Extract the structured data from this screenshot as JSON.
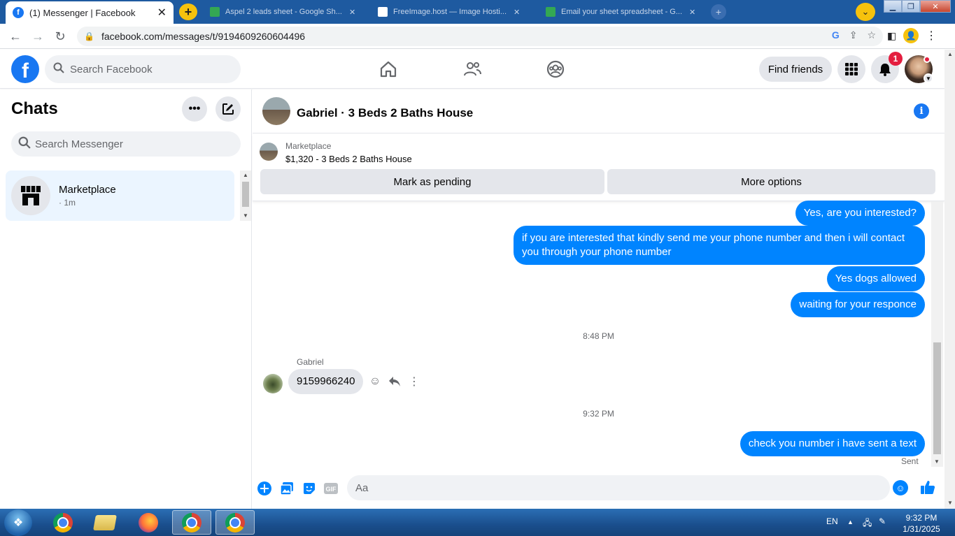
{
  "browser": {
    "active_tab_title": "(1) Messenger | Facebook",
    "inactive_tabs": [
      {
        "title": "Aspel 2 leads sheet - Google Sh...",
        "color": "#34a853"
      },
      {
        "title": "FreeImage.host — Image Hosti...",
        "color": "#ffffff"
      },
      {
        "title": "Email your sheet spreadsheet - G...",
        "color": "#34a853"
      }
    ],
    "url": "facebook.com/messages/t/9194609260604496"
  },
  "fb_header": {
    "search_placeholder": "Search Facebook",
    "find_friends_label": "Find friends",
    "notification_count": "1"
  },
  "sidebar": {
    "title": "Chats",
    "search_placeholder": "Search Messenger",
    "chats": [
      {
        "name": "Marketplace",
        "time": "· 1m"
      }
    ]
  },
  "conversation": {
    "title": "Gabriel · 3 Beds 2 Baths House",
    "marketplace_label": "Marketplace",
    "listing": "$1,320 - 3 Beds 2 Baths House",
    "mark_pending_label": "Mark as pending",
    "more_options_label": "More options",
    "outgoing_messages_1": [
      "Yes, are you interested?",
      "if you are interested that kindly send me your phone number and then i will contact you through your phone number",
      "Yes  dogs allowed",
      "waiting for your responce"
    ],
    "timestamp_1": "8:48 PM",
    "incoming_sender": "Gabriel",
    "incoming_message": "9159966240",
    "timestamp_2": "9:32 PM",
    "outgoing_message_2": "check you number i have sent a text",
    "sent_status": "Sent",
    "composer_placeholder": "Aa"
  },
  "taskbar": {
    "language": "EN",
    "time": "9:32 PM",
    "date": "1/31/2025"
  },
  "colors": {
    "messenger_blue": "#0084ff",
    "facebook_blue": "#1877f2",
    "selected_chat_bg": "#ebf5ff"
  }
}
